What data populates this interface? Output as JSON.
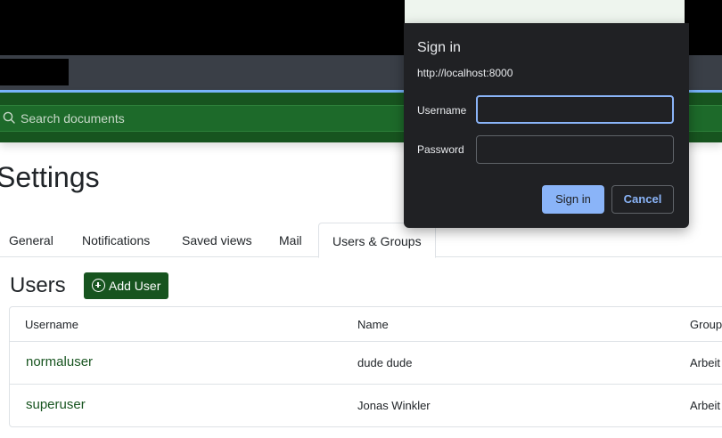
{
  "search": {
    "placeholder": "Search documents"
  },
  "page": {
    "title": "Settings"
  },
  "tabs": [
    {
      "label": "General"
    },
    {
      "label": "Notifications"
    },
    {
      "label": "Saved views"
    },
    {
      "label": "Mail"
    },
    {
      "label": "Users & Groups",
      "active": true
    }
  ],
  "users": {
    "heading": "Users",
    "add_button_label": "Add User",
    "columns": [
      "Username",
      "Name",
      "Group"
    ],
    "rows": [
      {
        "username": "normaluser",
        "name": "dude dude",
        "group": "Arbeit"
      },
      {
        "username": "superuser",
        "name": "Jonas Winkler",
        "group": "Arbeit"
      }
    ]
  },
  "dialog": {
    "title": "Sign in",
    "origin": "http://localhost:8000",
    "username_label": "Username",
    "password_label": "Password",
    "username_value": "",
    "password_value": "",
    "signin_label": "Sign in",
    "cancel_label": "Cancel"
  },
  "colors": {
    "brand": "#17541f",
    "accent": "#7ab7ff",
    "dialog_bg": "#202124",
    "dialog_button": "#8ab4f8"
  }
}
